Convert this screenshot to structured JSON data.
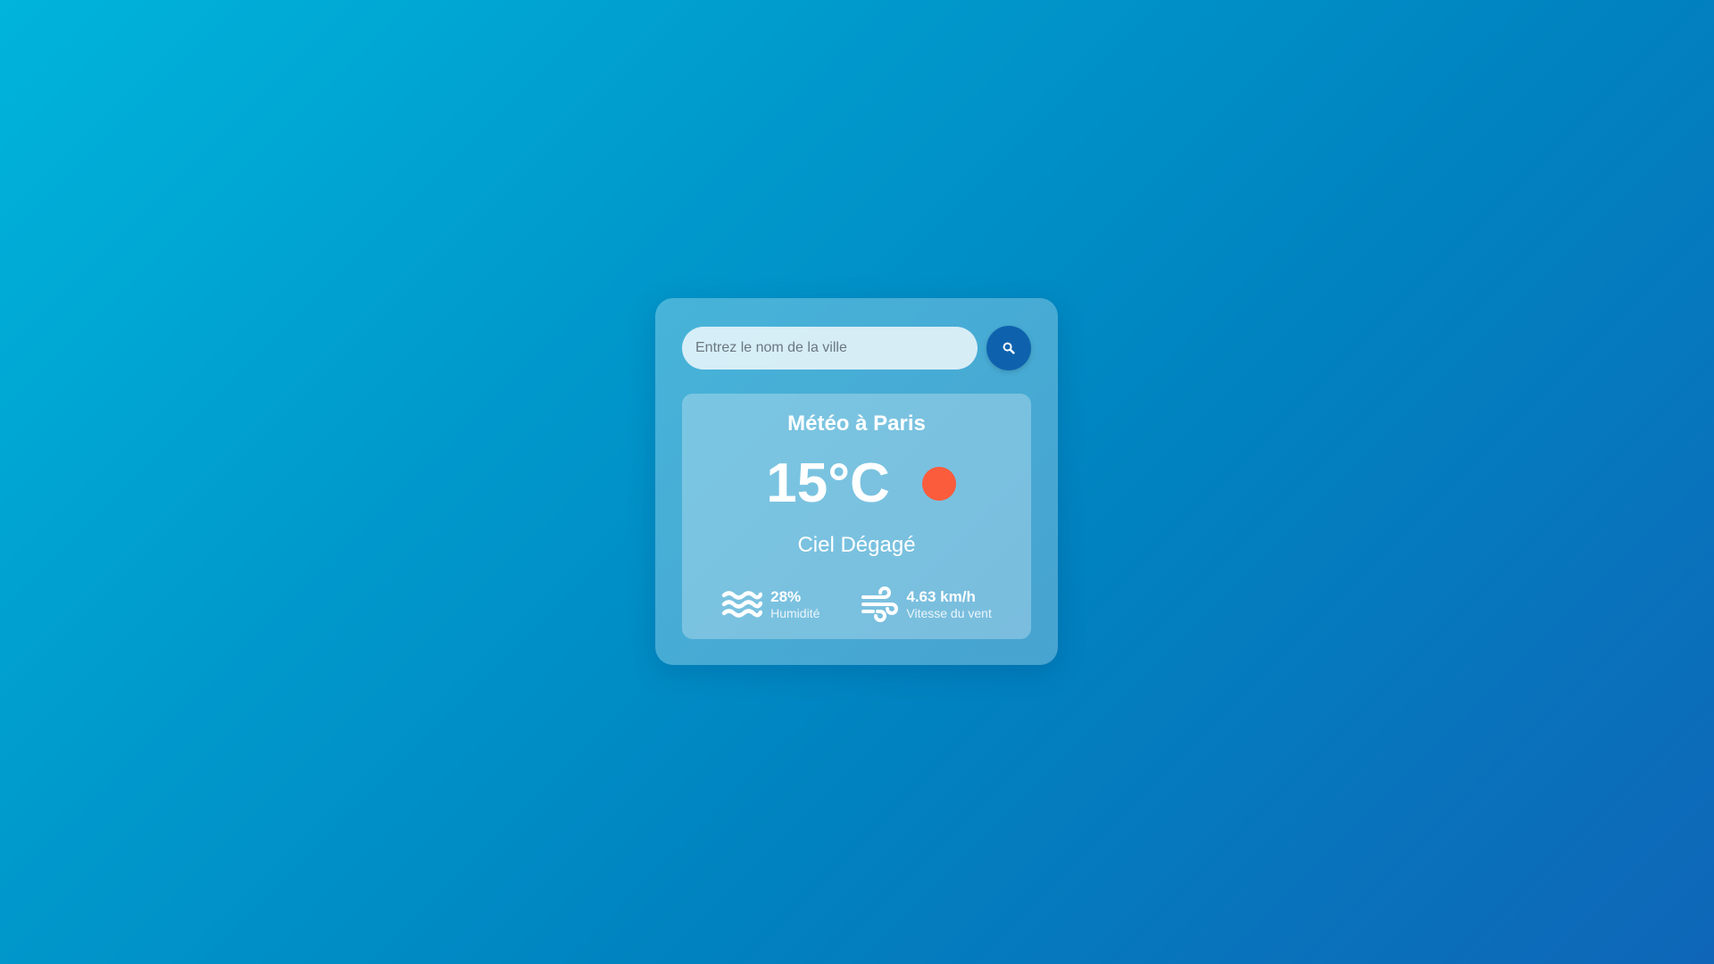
{
  "search": {
    "placeholder": "Entrez le nom de la ville",
    "value": "",
    "button_icon": "search-icon"
  },
  "weather": {
    "title": "Météo à Paris",
    "temperature": "15°C",
    "condition_icon": "sun-dot-icon",
    "condition_color": "#fa5c3c",
    "description": "Ciel Dégagé"
  },
  "details": {
    "humidity": {
      "icon": "water-waves-icon",
      "value": "28%",
      "label": "Humidité"
    },
    "wind": {
      "icon": "wind-icon",
      "value": "4.63 km/h",
      "label": "Vitesse du vent"
    }
  },
  "colors": {
    "background_start": "#00b4db",
    "background_end": "#0f66b8",
    "button": "#0e62ad",
    "text": "#ffffff"
  }
}
